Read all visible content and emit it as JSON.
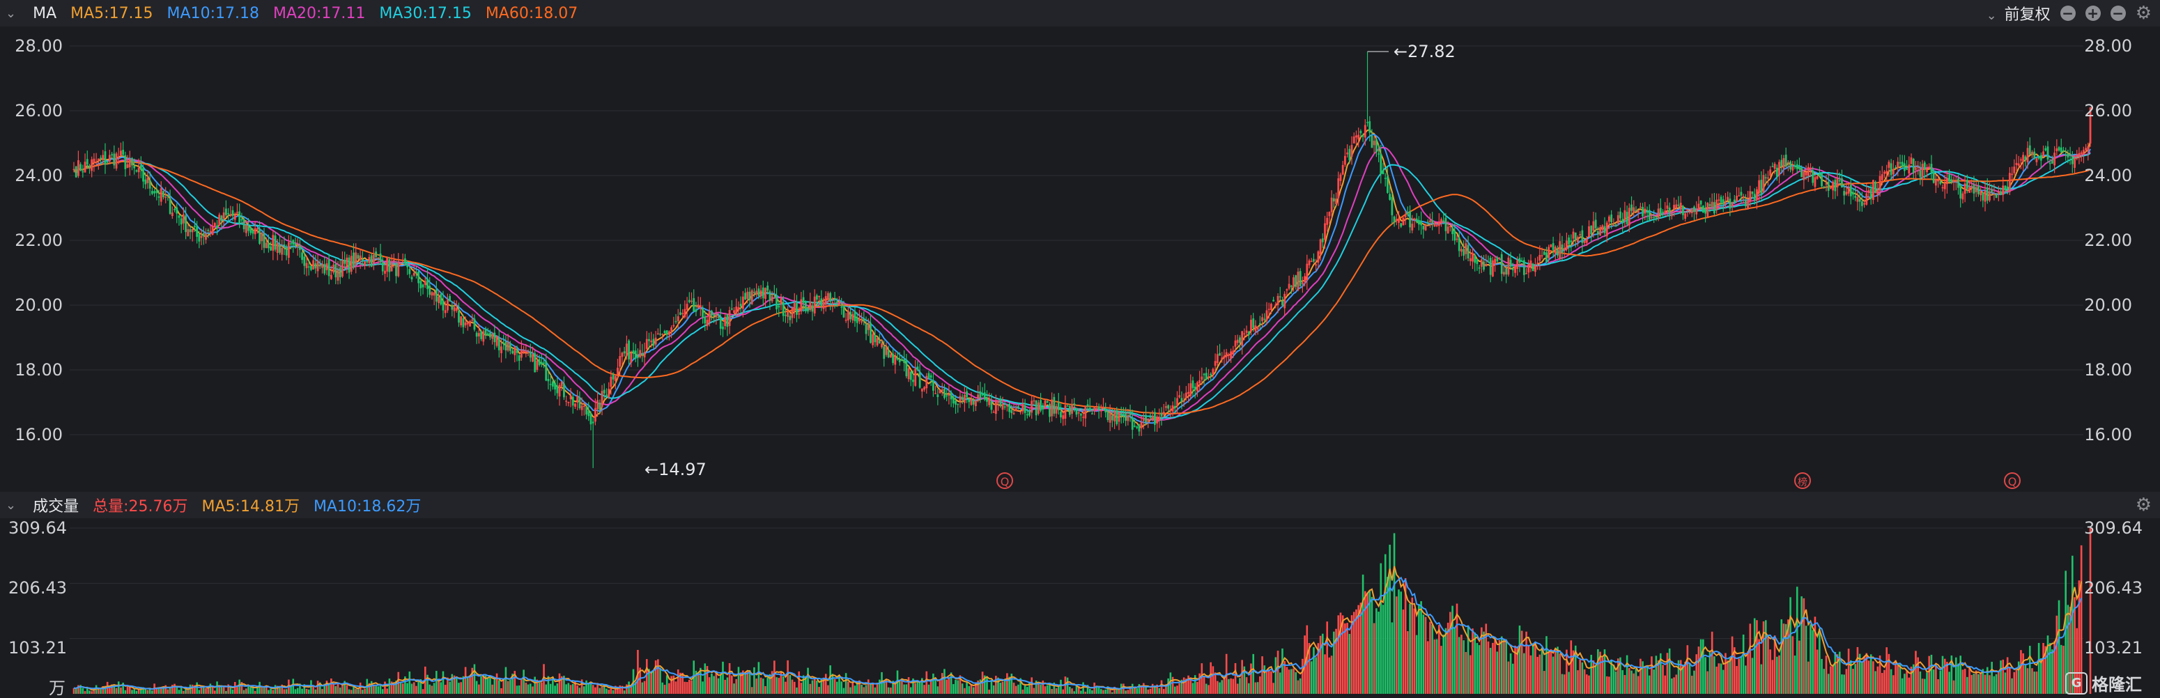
{
  "main_panel": {
    "indicator": "MA",
    "legend": [
      {
        "label": "MA5:17.15",
        "color": "#f0a030"
      },
      {
        "label": "MA10:17.18",
        "color": "#3d9bff"
      },
      {
        "label": "MA20:17.11",
        "color": "#e040c0"
      },
      {
        "label": "MA30:17.15",
        "color": "#20d0e0"
      },
      {
        "label": "MA60:18.07",
        "color": "#ff6a20"
      }
    ],
    "adjust_label": "前复权",
    "y_ticks": [
      "28.00",
      "26.00",
      "24.00",
      "22.00",
      "20.00",
      "18.00",
      "16.00"
    ],
    "high_label": "←27.82",
    "low_label": "←14.97",
    "markers": [
      "Q",
      "榜",
      "Q"
    ]
  },
  "volume_panel": {
    "title": "成交量",
    "legend": [
      {
        "label": "总量:25.76万",
        "color": "#ff4a4a"
      },
      {
        "label": "MA5:14.81万",
        "color": "#f0a030"
      },
      {
        "label": "MA10:18.62万",
        "color": "#3d9bff"
      }
    ],
    "y_ticks": [
      "309.64",
      "206.43",
      "103.21"
    ],
    "unit": "万"
  },
  "brand": {
    "name": "格隆汇",
    "icon": "logo-icon"
  },
  "colors": {
    "up": "#ff4a4a",
    "down": "#1fc36a",
    "background": "#1b1c20"
  },
  "chart_data": [
    {
      "type": "candlestick",
      "ylim": [
        15,
        28.6
      ],
      "y_ticks": [
        28,
        26,
        24,
        22,
        20,
        18,
        16
      ],
      "anchors": [
        [
          0,
          24.2
        ],
        [
          20,
          24.6
        ],
        [
          40,
          23.3
        ],
        [
          55,
          22.1
        ],
        [
          70,
          22.8
        ],
        [
          85,
          22.0
        ],
        [
          100,
          21.6
        ],
        [
          115,
          21.0
        ],
        [
          130,
          21.5
        ],
        [
          150,
          21.0
        ],
        [
          165,
          20.0
        ],
        [
          180,
          19.2
        ],
        [
          195,
          18.7
        ],
        [
          210,
          18.0
        ],
        [
          222,
          17.1
        ],
        [
          232,
          16.5
        ],
        [
          245,
          18.5
        ],
        [
          260,
          18.8
        ],
        [
          275,
          19.9
        ],
        [
          290,
          19.4
        ],
        [
          305,
          20.5
        ],
        [
          320,
          19.8
        ],
        [
          335,
          20.2
        ],
        [
          350,
          19.6
        ],
        [
          365,
          18.3
        ],
        [
          380,
          17.6
        ],
        [
          400,
          17.0
        ],
        [
          420,
          16.9
        ],
        [
          440,
          16.8
        ],
        [
          460,
          16.6
        ],
        [
          480,
          16.3
        ],
        [
          500,
          17.4
        ],
        [
          520,
          19.0
        ],
        [
          540,
          20.2
        ],
        [
          555,
          21.4
        ],
        [
          568,
          24.5
        ],
        [
          578,
          25.6
        ],
        [
          590,
          22.7
        ],
        [
          610,
          22.5
        ],
        [
          630,
          21.2
        ],
        [
          650,
          21.2
        ],
        [
          670,
          22.0
        ],
        [
          690,
          22.7
        ],
        [
          710,
          23.0
        ],
        [
          730,
          22.9
        ],
        [
          750,
          23.4
        ],
        [
          765,
          24.5
        ],
        [
          780,
          23.9
        ],
        [
          800,
          23.3
        ],
        [
          815,
          24.5
        ],
        [
          830,
          24.0
        ],
        [
          845,
          23.5
        ],
        [
          860,
          23.5
        ],
        [
          875,
          24.8
        ],
        [
          890,
          24.5
        ],
        [
          900,
          24.8
        ]
      ],
      "last_close": 26.1,
      "high": 27.82,
      "low": 14.97,
      "series": [
        {
          "name": "MA5",
          "period": 5
        },
        {
          "name": "MA10",
          "period": 10
        },
        {
          "name": "MA20",
          "period": 20
        },
        {
          "name": "MA30",
          "period": 30
        },
        {
          "name": "MA60",
          "period": 60
        }
      ]
    },
    {
      "type": "bar",
      "ylim": [
        0,
        309.64
      ],
      "y_ticks": [
        309.64,
        206.43,
        103.21
      ],
      "spikes": [
        [
          0,
          22
        ],
        [
          110,
          30
        ],
        [
          145,
          45
        ],
        [
          205,
          60
        ],
        [
          245,
          28
        ],
        [
          252,
          82
        ],
        [
          290,
          60
        ],
        [
          310,
          70
        ],
        [
          350,
          40
        ],
        [
          388,
          55
        ],
        [
          470,
          18
        ],
        [
          560,
          135
        ],
        [
          582,
          265
        ],
        [
          590,
          300
        ],
        [
          598,
          210
        ],
        [
          612,
          180
        ],
        [
          650,
          110
        ],
        [
          700,
          60
        ],
        [
          765,
          160
        ],
        [
          770,
          200
        ],
        [
          785,
          80
        ],
        [
          810,
          80
        ],
        [
          855,
          60
        ],
        [
          880,
          95
        ],
        [
          898,
          309.64
        ]
      ],
      "series": [
        {
          "name": "MA5",
          "period": 5
        },
        {
          "name": "MA10",
          "period": 10
        }
      ]
    }
  ]
}
